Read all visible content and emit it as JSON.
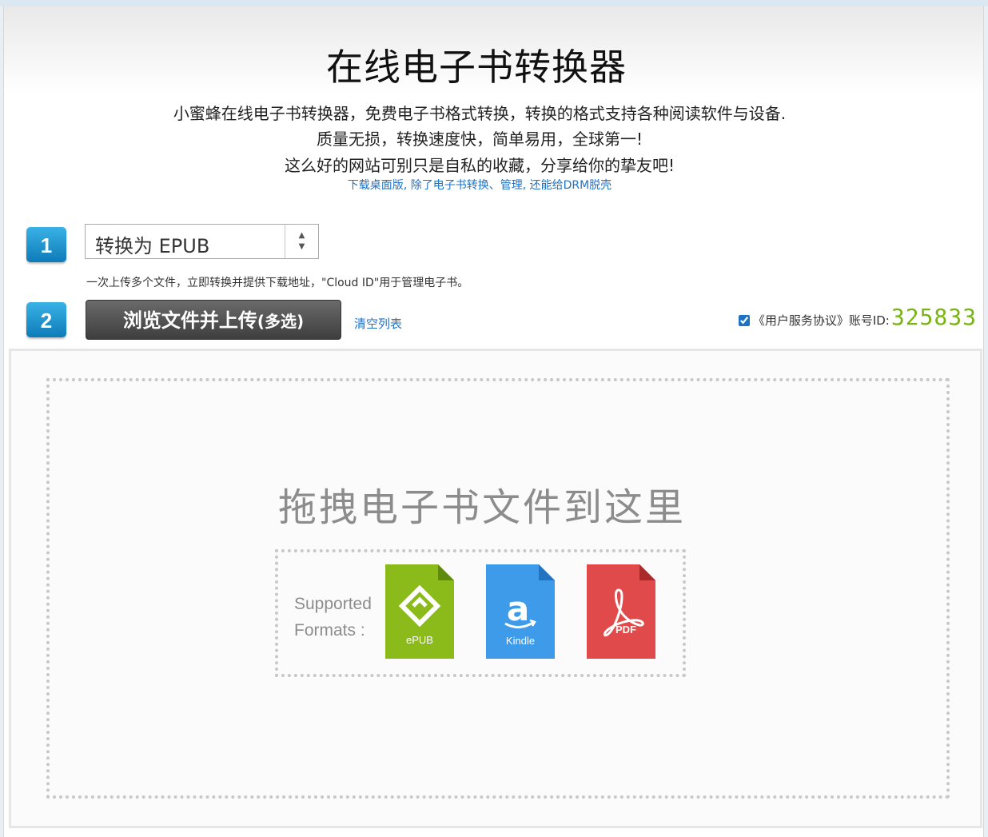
{
  "header": {
    "title": "在线电子书转换器",
    "description_lines": [
      "小蜜蜂在线电子书转换器，免费电子书格式转换，转换的格式支持各种阅读软件与设备.",
      "质量无损，转换速度快，简单易用，全球第一!",
      "这么好的网站可别只是自私的收藏，分享给你的挚友吧!"
    ],
    "desktop_link": "下载桌面版, 除了电子书转换、管理, 还能给DRM脱壳"
  },
  "step1": {
    "number": "1",
    "select_value": "转换为 EPUB",
    "select_arrow": "▴▾",
    "hint": "一次上传多个文件，立即转换并提供下载地址，\"Cloud ID\"用于管理电子书。"
  },
  "step2": {
    "number": "2",
    "upload_label_main": "浏览文件并上传",
    "upload_label_suffix": "(多选)",
    "clear_label": "清空列表",
    "agreement_label": "《用户服务协议》账号ID:",
    "agreement_checked": true,
    "account_id": "325833"
  },
  "dropzone": {
    "text": "拖拽电子书文件到这里",
    "supported_line1": "Supported",
    "supported_line2": "Formats :",
    "formats": [
      {
        "label": "ePUB",
        "color": "#8bbb1a",
        "icon": "epub-icon"
      },
      {
        "label": "Kindle",
        "color": "#3d9be9",
        "icon": "kindle-icon"
      },
      {
        "label": "PDF",
        "color": "#e04a4a",
        "icon": "pdf-icon"
      }
    ]
  },
  "colors": {
    "accent_blue": "#1e72c4",
    "badge_blue": "#1b8fcc",
    "account_green": "#7ab317"
  }
}
